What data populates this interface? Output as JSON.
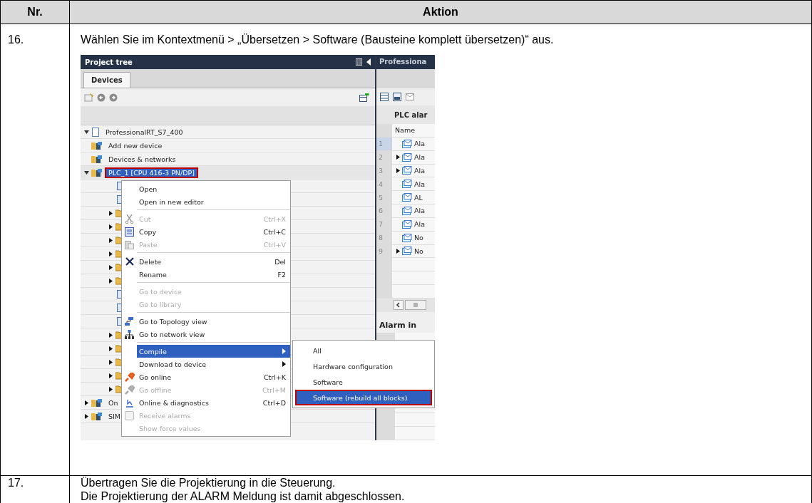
{
  "table": {
    "columns": [
      "Nr.",
      "Aktion"
    ],
    "rows": [
      {
        "number": "16.",
        "instruction": "Wählen Sie im Kontextmenü > „Übersetzen > Software (Bausteine komplett übersetzen)“ aus.",
        "screenshot": {
          "project_tree": {
            "title": "Project tree",
            "tabs": [
              {
                "label": "Devices",
                "selected": true
              }
            ],
            "tree": [
              {
                "label": "ProfessionalRT_S7_400",
                "expanded": true,
                "children": [
                  {
                    "label": "Add new device"
                  },
                  {
                    "label": "Devices & networks"
                  },
                  {
                    "label": "PLC_1 [CPU 416-3 PN/DP]",
                    "expanded": true,
                    "selected": true,
                    "highlighted": true,
                    "children": [
                      {
                        "kind": "item",
                        "expandable": false
                      },
                      {
                        "kind": "item",
                        "expandable": false
                      },
                      {
                        "kind": "folder",
                        "expandable": true
                      },
                      {
                        "kind": "folder",
                        "expandable": true
                      },
                      {
                        "kind": "folder",
                        "expandable": true
                      },
                      {
                        "kind": "folder",
                        "expandable": true
                      },
                      {
                        "kind": "folder",
                        "expandable": true
                      },
                      {
                        "kind": "folder",
                        "expandable": true
                      },
                      {
                        "kind": "item",
                        "expandable": false
                      },
                      {
                        "kind": "item",
                        "expandable": false
                      },
                      {
                        "kind": "item",
                        "expandable": false
                      },
                      {
                        "kind": "folder",
                        "expandable": true
                      },
                      {
                        "kind": "folder",
                        "expandable": true
                      },
                      {
                        "kind": "folder",
                        "expandable": true
                      },
                      {
                        "kind": "folder",
                        "expandable": true
                      },
                      {
                        "kind": "folder",
                        "expandable": true
                      }
                    ]
                  },
                  {
                    "label": "On",
                    "expanded": false
                  },
                  {
                    "label": "SIM",
                    "expanded": false
                  }
                ]
              }
            ]
          },
          "editor": {
            "title": "Professiona",
            "section_title": "PLC alar",
            "column": "Name",
            "rows": [
              {
                "number": "1",
                "name": "Ala",
                "expandable": false,
                "selected": true
              },
              {
                "number": "2",
                "name": "Ala",
                "expandable": true,
                "selected": false
              },
              {
                "number": "3",
                "name": "Ala",
                "expandable": true,
                "selected": false
              },
              {
                "number": "4",
                "name": "Ala",
                "expandable": false,
                "selected": false
              },
              {
                "number": "5",
                "name": "AL",
                "expandable": false,
                "selected": false
              },
              {
                "number": "6",
                "name": "Ala",
                "expandable": false,
                "selected": false
              },
              {
                "number": "7",
                "name": "Ala",
                "expandable": false,
                "selected": false
              },
              {
                "number": "8",
                "name": "No",
                "expandable": false,
                "selected": false
              },
              {
                "number": "9",
                "name": "No",
                "expandable": true,
                "selected": false
              }
            ],
            "section_title_2": "Alarm in"
          },
          "context_menu": {
            "groups": [
              [
                {
                  "label": "Open",
                  "disabled": false,
                  "selected": false,
                  "submenu": false
                },
                {
                  "label": "Open in new editor",
                  "disabled": false,
                  "selected": false,
                  "submenu": false
                }
              ],
              [
                {
                  "label": "Cut",
                  "shortcut": "Ctrl+X",
                  "disabled": true,
                  "selected": false,
                  "submenu": false
                },
                {
                  "label": "Copy",
                  "shortcut": "Ctrl+C",
                  "disabled": false,
                  "selected": false,
                  "submenu": false
                },
                {
                  "label": "Paste",
                  "shortcut": "Ctrl+V",
                  "disabled": true,
                  "selected": false,
                  "submenu": false
                }
              ],
              [
                {
                  "label": "Delete",
                  "shortcut": "Del",
                  "disabled": false,
                  "selected": false,
                  "submenu": false
                },
                {
                  "label": "Rename",
                  "shortcut": "F2",
                  "disabled": false,
                  "selected": false,
                  "submenu": false
                }
              ],
              [
                {
                  "label": "Go to device",
                  "disabled": true,
                  "selected": false,
                  "submenu": false
                },
                {
                  "label": "Go to library",
                  "disabled": true,
                  "selected": false,
                  "submenu": false
                }
              ],
              [
                {
                  "label": "Go to Topology view",
                  "disabled": false,
                  "selected": false,
                  "submenu": false
                },
                {
                  "label": "Go to network view",
                  "disabled": false,
                  "selected": false,
                  "submenu": false
                }
              ],
              [
                {
                  "label": "Compile",
                  "disabled": false,
                  "selected": true,
                  "submenu": true
                },
                {
                  "label": "Download to device",
                  "disabled": false,
                  "selected": false,
                  "submenu": true
                },
                {
                  "label": "Go online",
                  "shortcut": "Ctrl+K",
                  "disabled": false,
                  "selected": false,
                  "submenu": false
                },
                {
                  "label": "Go offline",
                  "shortcut": "Ctrl+M",
                  "disabled": true,
                  "selected": false,
                  "submenu": false
                },
                {
                  "label": "Online & diagnostics",
                  "shortcut": "Ctrl+D",
                  "disabled": false,
                  "selected": false,
                  "submenu": false
                },
                {
                  "label": "Receive alarms",
                  "disabled": true,
                  "selected": false,
                  "submenu": false
                },
                {
                  "label": "Show force values",
                  "disabled": true,
                  "selected": false,
                  "submenu": false
                }
              ]
            ]
          },
          "submenu": {
            "items": [
              {
                "label": "All",
                "selected": false,
                "highlighted": false
              },
              {
                "label": "Hardware configuration",
                "selected": false,
                "highlighted": false
              },
              {
                "label": "Software",
                "selected": false,
                "highlighted": false
              },
              {
                "label": "Software (rebuild all blocks)",
                "selected": true,
                "highlighted": true
              }
            ]
          }
        }
      },
      {
        "number": "17.",
        "lines": [
          "Übertragen Sie die Projektierung in die Steuerung.",
          "Die Projektierung der ALARM Meldung ist damit abgeschlossen."
        ]
      }
    ]
  }
}
